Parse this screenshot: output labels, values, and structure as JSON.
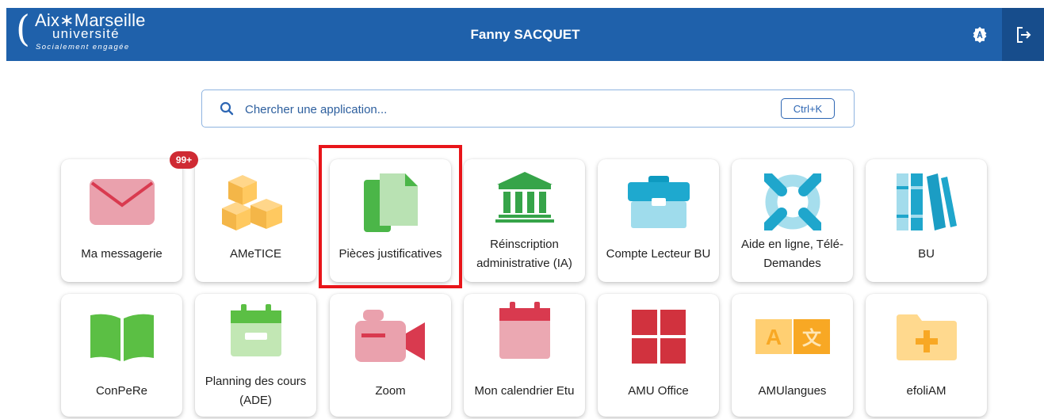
{
  "header": {
    "logo": {
      "line1": "Aix∗Marseille",
      "line2": "université",
      "line3": "Socialement engagée"
    },
    "user_name": "Fanny SACQUET",
    "accessibility_icon": "accessibility-badge-icon",
    "logout_icon": "logout-icon",
    "colors": {
      "bar": "#1f61ab",
      "logout_bg": "#174d8c"
    }
  },
  "search": {
    "placeholder": "Chercher une application...",
    "shortcut": "Ctrl+K",
    "icon": "search-icon"
  },
  "notifications": {
    "messagerie_badge": "99+"
  },
  "tiles": [
    {
      "label": "Ma messagerie",
      "icon": "envelope-icon"
    },
    {
      "label": "AMeTICE",
      "icon": "boxes-icon"
    },
    {
      "label": "Pièces justificatives",
      "icon": "documents-icon",
      "highlighted": true
    },
    {
      "label": "Réinscription administrative (IA)",
      "icon": "institution-icon"
    },
    {
      "label": "Compte Lecteur BU",
      "icon": "briefcase-icon"
    },
    {
      "label": "Aide en ligne, Télé-Demandes",
      "icon": "lifebuoy-icon"
    },
    {
      "label": "BU",
      "icon": "books-icon"
    },
    {
      "label": "ConPeRe",
      "icon": "open-book-icon"
    },
    {
      "label": "Planning des cours (ADE)",
      "icon": "calendar-green-icon"
    },
    {
      "label": "Zoom",
      "icon": "video-camera-icon"
    },
    {
      "label": "Mon calendrier Etu",
      "icon": "calendar-red-icon"
    },
    {
      "label": "AMU Office",
      "icon": "office-grid-icon"
    },
    {
      "label": "AMUlangues",
      "icon": "translate-icon"
    },
    {
      "label": "efoliAM",
      "icon": "folder-plus-icon"
    }
  ]
}
